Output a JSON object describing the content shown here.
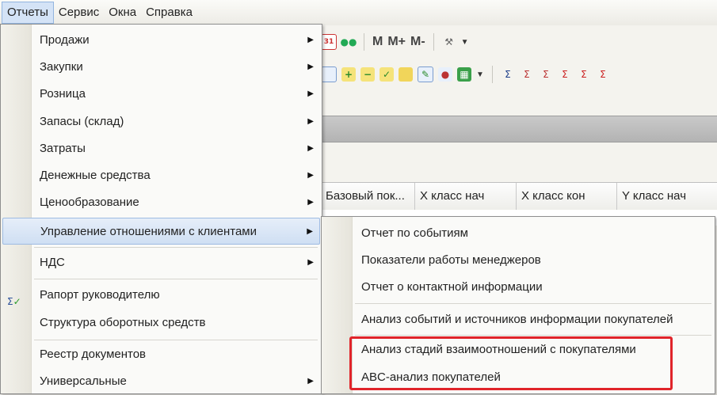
{
  "menubar": {
    "items": [
      "Отчеты",
      "Сервис",
      "Окна",
      "Справка"
    ]
  },
  "toolbar": {
    "row1": {
      "calendar_day": "31",
      "m": "M",
      "m_plus": "M+",
      "m_minus": "M-"
    }
  },
  "grid": {
    "columns": [
      "Базовый пок...",
      "X класс нач",
      "X класс кон",
      "Y класс нач"
    ]
  },
  "main_menu": {
    "items": [
      {
        "label": "Продажи",
        "submenu": true
      },
      {
        "label": "Закупки",
        "submenu": true
      },
      {
        "label": "Розница",
        "submenu": true
      },
      {
        "label": "Запасы (склад)",
        "submenu": true
      },
      {
        "label": "Затраты",
        "submenu": true
      },
      {
        "label": "Денежные средства",
        "submenu": true
      },
      {
        "label": "Ценообразование",
        "submenu": true
      },
      {
        "label": "Управление отношениями с клиентами",
        "submenu": true,
        "highlighted": true
      },
      {
        "label": "НДС",
        "submenu": true
      },
      {
        "label": "Рапорт руководителю",
        "icon": "report-sigma-check-icon"
      },
      {
        "label": "Структура оборотных средств"
      },
      {
        "label": "Реестр документов"
      },
      {
        "label": "Универсальные",
        "submenu": true
      }
    ]
  },
  "submenu": {
    "items": [
      "Отчет по событиям",
      "Показатели работы менеджеров",
      "Отчет о контактной информации",
      "Анализ событий и источников информации покупателей",
      "Анализ стадий взаимоотношений с покупателями",
      "ABC-анализ покупателей"
    ]
  },
  "colors": {
    "highlight_border": "#e0242a",
    "menu_hover": "#cfdff3"
  }
}
